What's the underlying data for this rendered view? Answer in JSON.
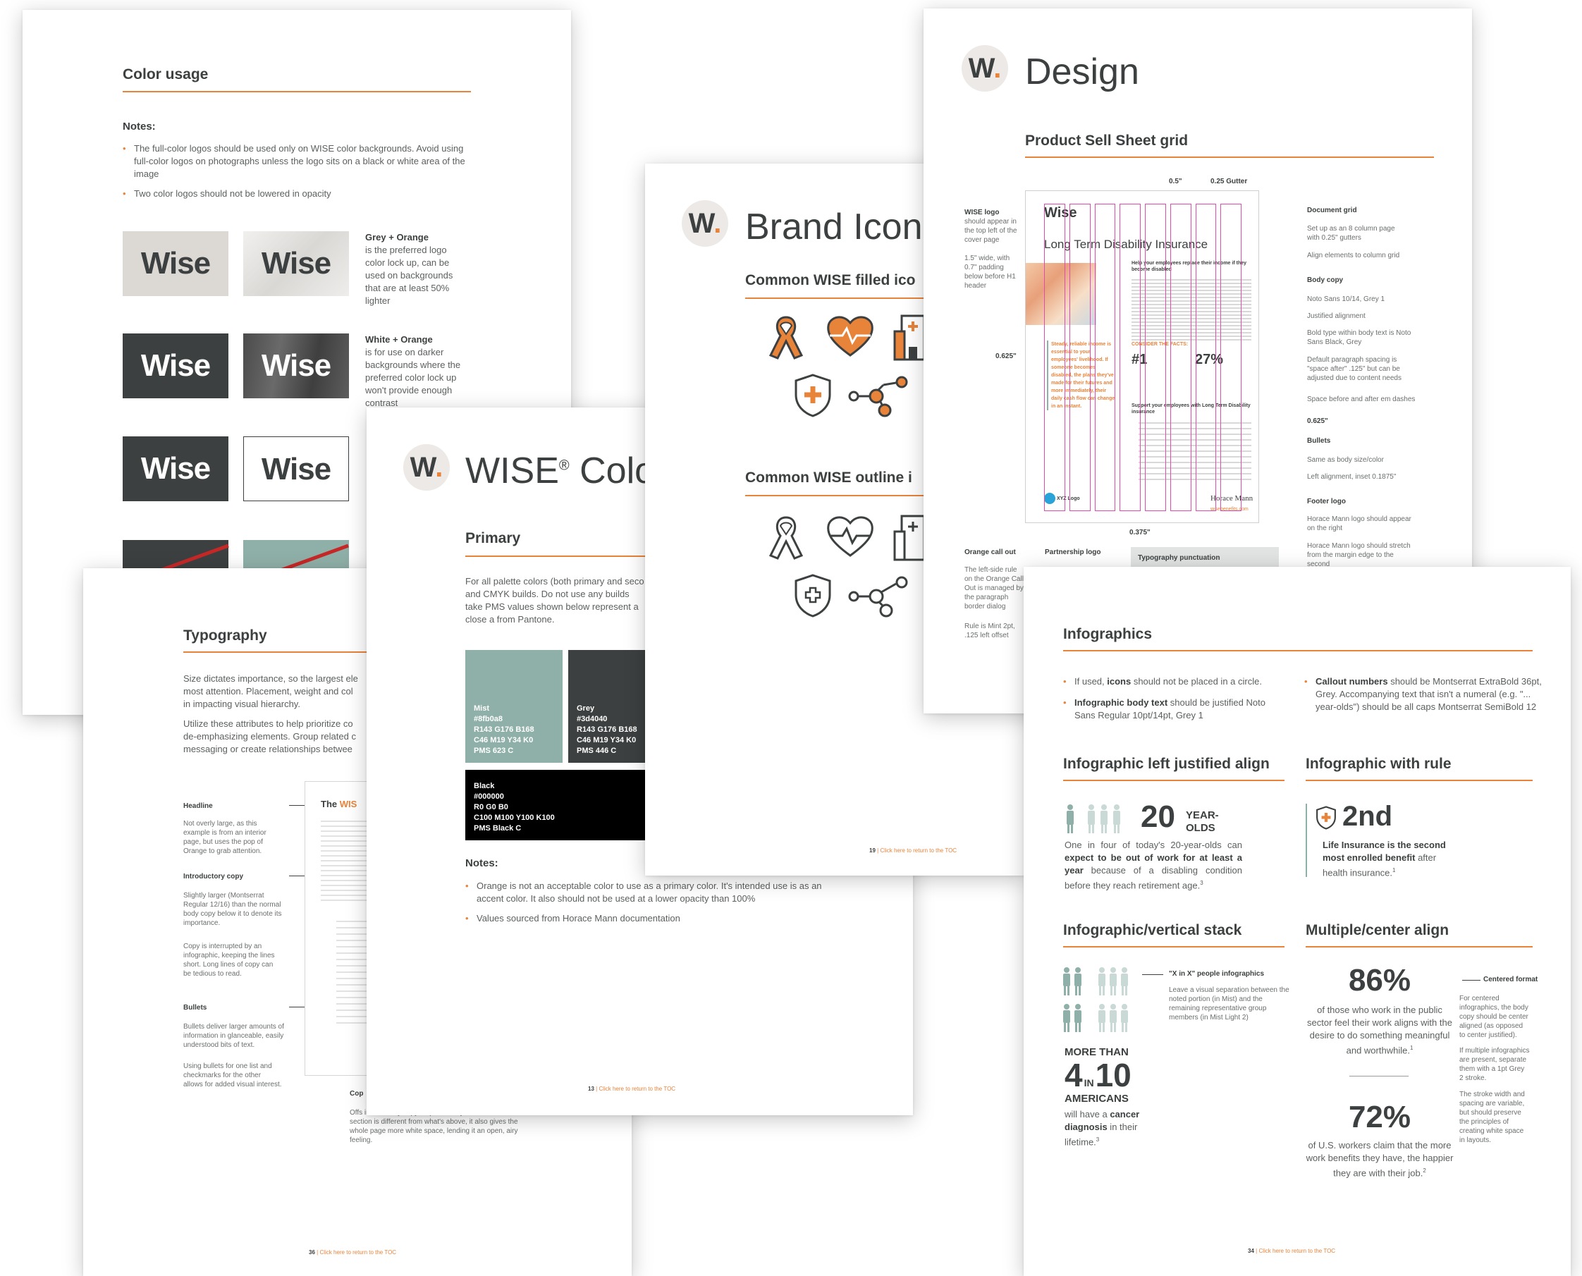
{
  "colors": {
    "orange": "#e8833a",
    "grey": "#3d4040",
    "mist": "#8fb0a8",
    "black": "#000000",
    "pink_grid": "#e04bb0"
  },
  "color_usage": {
    "title": "Color usage",
    "notes_label": "Notes:",
    "notes": [
      "The full-color logos should be used only on WISE color backgrounds. Avoid using full-color logos on photographs unless the logo sits on a black or white area of the image",
      "Two color logos should not be lowered in opacity"
    ],
    "logo_text": "Wise",
    "grey_orange_title": "Grey + Orange",
    "grey_orange_desc": "is the preferred logo color lock up, can be used on backgrounds that are at least 50% lighter",
    "white_orange_title": "White + Orange",
    "white_orange_desc": "is for use on darker backgrounds where the preferred color lock up won't provide enough contrast"
  },
  "design": {
    "title": "Design",
    "section": "Product Sell Sheet grid",
    "gutter_a": "0.5\"",
    "gutter_b": "0.25 Gutter",
    "sheet_title": "Long Term Disability Insurance",
    "logo_small": "Wise",
    "wise_logo_label": "WISE logo",
    "wise_logo_desc": "should appear in the top left of the cover page",
    "padding_desc": "1.5\" wide, with 0.7\" padding below before H1 header",
    "margin_left": "0.625\"",
    "document_grid_label": "Document grid",
    "document_grid_desc": "Set up as an 8 column page with 0.25\" gutters",
    "align_desc": "Align elements to column grid",
    "body_copy_label": "Body copy",
    "body_copy_1": "Noto Sans 10/14, Grey 1",
    "body_copy_2": "Justified alignment",
    "body_copy_3": "Bold type within body text is Noto Sans Black, Grey",
    "body_copy_4": "Default paragraph spacing is \"space after\" .125\" but can be adjusted due to content needs",
    "body_copy_5": "Space before and after em dashes",
    "right_margin": "0.625\"",
    "bullets_label": "Bullets",
    "bullets_1": "Same as body size/color",
    "bullets_2": "Left alignment, inset 0.1875\"",
    "footer_logo_label": "Footer logo",
    "footer_logo_1": "Horace Mann logo should appear on the right",
    "footer_logo_2": "Horace Mann logo should stretch from the margin edge to the second",
    "bottom_margin": "0.375\"",
    "orange_callout_label": "Orange call out",
    "orange_callout_desc": "The left-side rule on the Orange Call Out is managed by the paragraph border dialog",
    "orange_callout_rule": "Rule is Mint 2pt, .125 left offset",
    "partnership_label": "Partnership logo",
    "typo_punct": "Typography punctuation",
    "callout_text": "Steady, reliable income is essential to your employees' livelihood. If someone becomes disabled, the plans they've made for their futures and more immediately, their daily cash flow can change in an instant.",
    "consider": "CONSIDER THE FACTS:",
    "fact1": "#1",
    "fact2": "27%",
    "help_head": "Help your employees replace their income if they become disabled",
    "support_head": "Support your employees with Long Term Disability insurance",
    "xyz": "XYZ Logo",
    "hm": "Horace Mann",
    "site": "wisebenefits.com"
  },
  "brand_icons": {
    "title": "Brand Icon",
    "filled": "Common WISE filled ico",
    "outline": "Common WISE outline i",
    "footer_page": "19",
    "footer_link": "Click here to return to the TOC"
  },
  "wise_colors": {
    "title": "WISE",
    "reg": "®",
    "title_rest": "Colo",
    "primary": "Primary",
    "intro": "For all palette colors (both primary and seco and CMYK builds. Do not use any builds take PMS values shown below represent a close a from Pantone.",
    "mist": {
      "name": "Mist",
      "hex": "#8fb0a8",
      "rgb": "R143 G176 B168",
      "cmyk": "C46 M19 Y34 K0",
      "pms": "PMS 623 C"
    },
    "grey": {
      "name": "Grey",
      "hex": "#3d4040",
      "rgb": "R143 G176 B168",
      "cmyk": "C46 M19 Y34 K0",
      "pms": "PMS 446 C"
    },
    "black": {
      "name": "Black",
      "hex": "#000000",
      "rgb": "R0 G0 B0",
      "cmyk": "C100 M100 Y100 K100",
      "pms": "PMS Black C"
    },
    "notes_label": "Notes:",
    "note1": "Orange is not an acceptable color to use as a primary color. It's intended use is as an accent color. It also should not be used at a lower opacity than 100%",
    "note2": "Values sourced from Horace Mann documentation",
    "footer_page": "13",
    "footer_link": "Click here to return to the TOC"
  },
  "typography": {
    "title": "Typography",
    "intro1": "Size dictates importance, so the largest ele most attention. Placement, weight and col in impacting visual hierarchy.",
    "intro2": "Utilize these attributes to help prioritize co de-emphasizing elements. Group related c messaging or create relationships betwee",
    "headline_label": "Headline",
    "headline_desc": "Not overly large, as this example is from an interior page, but uses the pop of Orange to grab attention.",
    "intro_label": "Introductory copy",
    "intro_desc": "Slightly larger (Montserrat Regular 12/16) than the normal body copy below it to denote its importance.",
    "intro_desc2": "Copy is interrupted by an infographic, keeping the lines short. Long lines of copy can be tedious to read.",
    "bullets_label": "Bullets",
    "bullets_desc": "Bullets deliver larger amounts of information in glanceable, easily understood bits of text.",
    "bullets_desc2": "Using bullets for one list and checkmarks for the other allows for added visual interest.",
    "sample_the": "The",
    "sample_wise": "WIS",
    "cop_label": "Cop",
    "cop_desc": "Offs introductory copy helps not only indicate that this section is different from what's above, it also gives the whole page more white space, lending it an open, airy feeling.",
    "footer_page": "36",
    "footer_link": "Click here to return to the TOC"
  },
  "infographics": {
    "title": "Infographics",
    "b1_pre": "If used, ",
    "b1_bold": "icons",
    "b1_post": " should not be placed in a circle.",
    "b2_bold": "Infographic body text",
    "b2_post": " should be justified Noto Sans Regular 10pt/14pt, Grey 1",
    "b3_bold": "Callout numbers",
    "b3_post": " should be Montserrat ExtraBold 36pt, Grey. Accompanying text that isn't a numeral (e.g. \"... year-olds\") should be all caps Montserrat SemiBold 12",
    "left_title": "Infographic left justified align",
    "rule_title": "Infographic with rule",
    "n20": "20",
    "year": "YEAR-",
    "olds": "OLDS",
    "left_desc_a": "One in four of today's 20-year-olds can ",
    "left_desc_b": "expect to be out of work for at least a year",
    "left_desc_c": " because of a disabling condition before they reach retirement age.",
    "sup3": "3",
    "n2": "2nd",
    "rule_desc_b": "Life Insurance is the second most enrolled benefit",
    "rule_desc_c": " after health insurance.",
    "sup1": "1",
    "vstack_title": "Infographic/vertical stack",
    "xinx_label": "\"X in X\" people infographics",
    "xinx_desc": "Leave a visual separation between the noted portion (in Mist) and the remaining representative group members (in Mist Light 2)",
    "more_than": "MORE THAN",
    "n4": "4",
    "in": "IN",
    "n10": "10",
    "americans": "AMERICANS",
    "cancer_a": "will have a ",
    "cancer_b": "cancer diagnosis",
    "cancer_c": " in their lifetime.",
    "center_title": "Multiple/center align",
    "p86": "86%",
    "p86_desc": "of those who work in the public sector feel their work aligns with the desire to do something meaningful and worthwhile.",
    "p72": "72%",
    "p72_desc": "of U.S. workers claim that the more work benefits they have, the happier they are with their job.",
    "sup2": "2",
    "centered_label": "Centered format",
    "centered_desc": "For centered infographics, the body copy should be center aligned (as opposed to center justified).",
    "centered_desc2": "If multiple infographics are present, separate them with a 1pt Grey 2 stroke.",
    "centered_desc3": "The stroke width and spacing are variable, but should preserve the principles of creating white space in layouts.",
    "footer_page": "34",
    "footer_link": "Click here to return to the TOC"
  }
}
